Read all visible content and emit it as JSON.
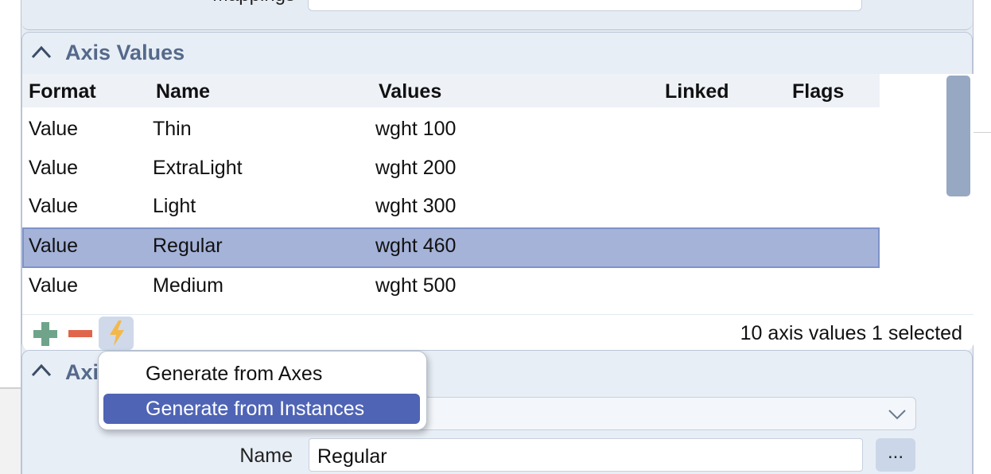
{
  "top": {
    "mappings_label": "Mappings"
  },
  "axis_values": {
    "title": "Axis Values",
    "columns": [
      "Format",
      "Name",
      "Values",
      "Linked",
      "Flags"
    ],
    "rows": [
      {
        "format": "Value",
        "name": "Thin",
        "values": "wght 100",
        "linked": "",
        "flags": ""
      },
      {
        "format": "Value",
        "name": "ExtraLight",
        "values": "wght 200",
        "linked": "",
        "flags": ""
      },
      {
        "format": "Value",
        "name": "Light",
        "values": "wght 300",
        "linked": "",
        "flags": ""
      },
      {
        "format": "Value",
        "name": "Regular",
        "values": "wght 460",
        "linked": "",
        "flags": "",
        "selected": true
      },
      {
        "format": "Value",
        "name": "Medium",
        "values": "wght 500",
        "linked": "",
        "flags": ""
      }
    ],
    "status": "10 axis values 1 selected",
    "icons": {
      "add": "plus-icon",
      "remove": "minus-icon",
      "generate": "lightning-icon"
    },
    "colors": {
      "add": "#6fa48a",
      "remove": "#e0654b",
      "generate": "#f2b84a",
      "selection": "#a5b3d9"
    }
  },
  "lower_section": {
    "title": "Axi",
    "name_label": "Name",
    "name_value": "Regular",
    "more_label": "..."
  },
  "popup_menu": {
    "items": [
      {
        "label": "Generate from Axes",
        "highlighted": false
      },
      {
        "label": "Generate from Instances",
        "highlighted": true
      }
    ],
    "highlight_color": "#4f64b5"
  }
}
